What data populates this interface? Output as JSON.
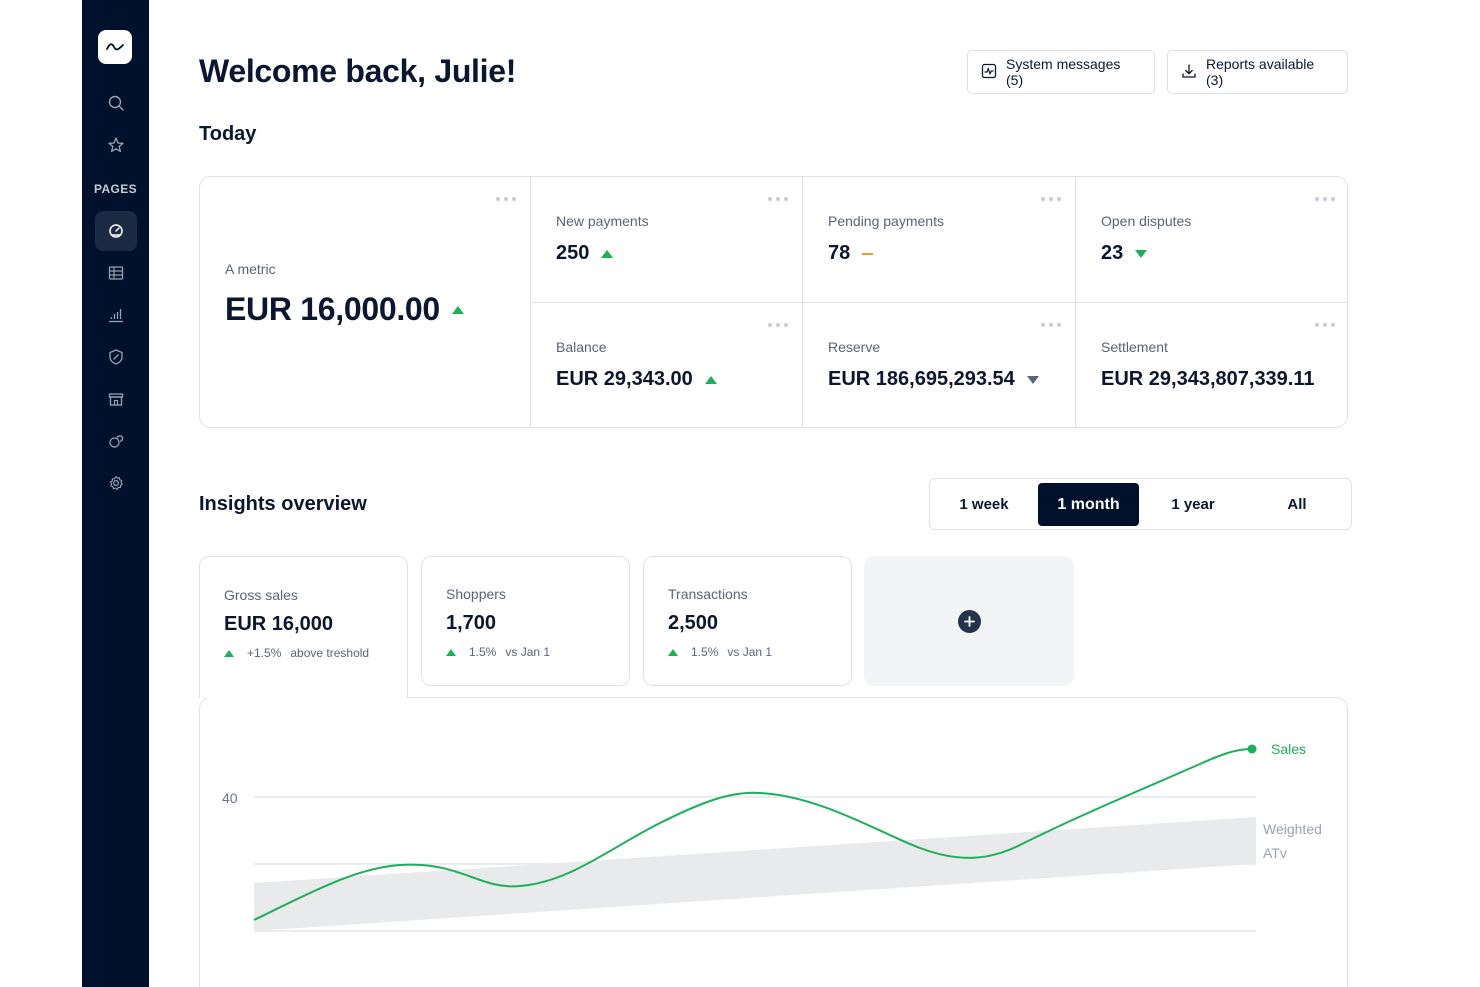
{
  "sidebar": {
    "pages_label": "PAGES",
    "icons": [
      "logo-icon",
      "search-icon",
      "star-icon",
      "dashboard-icon",
      "table-icon",
      "bar-chart-icon",
      "shield-icon",
      "store-icon",
      "link-icon",
      "gear-icon"
    ]
  },
  "header": {
    "welcome": "Welcome back, Julie!",
    "system_messages": "System messages (5)",
    "reports_available": "Reports available (3)"
  },
  "today": {
    "title": "Today",
    "main_metric": {
      "label": "A metric",
      "value": "EUR 16,000.00",
      "trend": "up"
    },
    "metrics": [
      {
        "label": "New payments",
        "value": "250",
        "trend": "up"
      },
      {
        "label": "Pending payments",
        "value": "78",
        "trend": "flat"
      },
      {
        "label": "Open disputes",
        "value": "23",
        "trend": "down"
      },
      {
        "label": "Balance",
        "value": "EUR 29,343.00",
        "trend": "up"
      },
      {
        "label": "Reserve",
        "value": "EUR 186,695,293.54",
        "trend": "down"
      },
      {
        "label": "Settlement",
        "value": "EUR 29,343,807,339.11",
        "trend": "none"
      }
    ]
  },
  "insights": {
    "title": "Insights overview",
    "ranges": [
      "1 week",
      "1 month",
      "1 year",
      "All"
    ],
    "active_range": "1 month",
    "kpis": [
      {
        "label": "Gross sales",
        "value": "EUR 16,000",
        "change": "+1.5%",
        "note": "above treshold"
      },
      {
        "label": "Shoppers",
        "value": "1,700",
        "change": "1.5%",
        "note": "vs Jan 1"
      },
      {
        "label": "Transactions",
        "value": "2,500",
        "change": "1.5%",
        "note": "vs Jan 1"
      }
    ]
  },
  "chart_data": {
    "type": "line",
    "ytick_labels": [
      "40"
    ],
    "series": [
      {
        "name": "Sales",
        "color": "#1cb05a",
        "values": [
          14,
          29,
          24,
          42,
          27,
          48
        ]
      },
      {
        "name": "Weighted ATv",
        "color": "#e9eaeb",
        "band": [
          [
            9,
            17
          ],
          [
            30,
            39
          ]
        ]
      }
    ]
  }
}
